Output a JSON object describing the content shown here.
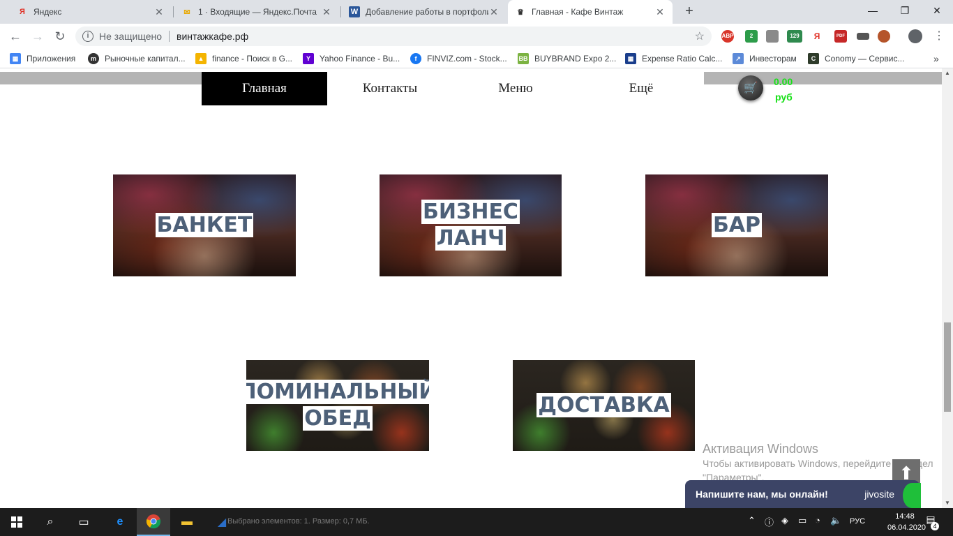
{
  "browser": {
    "tabs": [
      {
        "title": "Яндекс",
        "icon": "yandex-icon",
        "active": false
      },
      {
        "title": "1 · Входящие — Яндекс.Почта",
        "icon": "mail-icon",
        "active": false
      },
      {
        "title": "Добавление работы в портфоли",
        "icon": "word-icon",
        "active": false
      },
      {
        "title": "Главная - Кафе Винтаж",
        "icon": "chef-hat-icon",
        "active": true
      }
    ],
    "new_tab": "+",
    "window_controls": {
      "minimize": "—",
      "maximize": "❐",
      "close": "✕"
    },
    "omnibox": {
      "security_label": "Не защищено",
      "url": "винтажкафе.рф"
    },
    "extensions": [
      {
        "icon": "adblock-icon",
        "label": "ABP",
        "color": "#d9352a"
      },
      {
        "icon": "shield-green-icon",
        "label": "2",
        "color": "#2d9c4a"
      },
      {
        "icon": "shield-gray-icon",
        "label": "",
        "color": "#8a8a8a"
      },
      {
        "icon": "lock-counter-icon",
        "label": "129",
        "color": "#2f8a4e"
      },
      {
        "icon": "yandex-ext-icon",
        "label": "Я",
        "color": "#e03126"
      },
      {
        "icon": "pdf-icon",
        "label": "PDF",
        "color": "#c62828"
      },
      {
        "icon": "hat-icon",
        "label": "",
        "color": "#555555"
      },
      {
        "icon": "avatar-ext-icon",
        "label": "",
        "color": "#b5542a"
      }
    ],
    "bookmarks": [
      {
        "label": "Приложения",
        "icon": "apps-grid-icon",
        "color": "#4285f4"
      },
      {
        "label": "Рыночные капитал...",
        "icon": "chart-logo-icon",
        "color": "#333333"
      },
      {
        "label": "finance - Поиск в G...",
        "icon": "google-drive-icon",
        "color": "#f4b400"
      },
      {
        "label": "Yahoo Finance - Bu...",
        "icon": "yahoo-icon",
        "color": "#6001d2"
      },
      {
        "label": "FINVIZ.com - Stock...",
        "icon": "facebook-icon",
        "color": "#1877f2"
      },
      {
        "label": "BUYBRAND Expo 2...",
        "icon": "bb-icon",
        "color": "#7cb342"
      },
      {
        "label": "Expense Ratio Calc...",
        "icon": "calculator-icon",
        "color": "#1a3e8c"
      },
      {
        "label": "Инвесторам",
        "icon": "link-icon",
        "color": "#5c8ad8"
      },
      {
        "label": "Conomy — Сервис...",
        "icon": "conomy-icon",
        "color": "#2e3b2a"
      }
    ],
    "bookmarks_more": "»"
  },
  "site": {
    "nav": [
      {
        "label": "Главная",
        "active": true
      },
      {
        "label": "Контакты",
        "active": false
      },
      {
        "label": "Меню",
        "active": false
      },
      {
        "label": "Ещё",
        "active": false
      }
    ],
    "cart": {
      "amount": "0.00",
      "currency": "руб"
    },
    "tiles": [
      {
        "lines": [
          "БАНКЕТ"
        ],
        "style": "restaurant"
      },
      {
        "lines": [
          "БИЗНЕС",
          "ЛАНЧ"
        ],
        "style": "restaurant"
      },
      {
        "lines": [
          "БАР"
        ],
        "style": "restaurant"
      },
      {
        "lines": [
          "ПОМИНАЛЬНЫЙ",
          "ОБЕД"
        ],
        "style": "food"
      },
      {
        "lines": [
          "ДОСТАВКА"
        ],
        "style": "food"
      }
    ],
    "windows_activation": {
      "title": "Активация Windows",
      "text": "Чтобы активировать Windows, перейдите в раздел \"Параметры\"."
    },
    "chat": {
      "message": "Напишите нам, мы онлайн!",
      "brand": "jivosite"
    }
  },
  "taskbar": {
    "status_text": "Выбрано элементов: 1. Размер: 0,7 МБ.",
    "language": "РУС",
    "time": "14:48",
    "date": "06.04.2020",
    "notifications": "4"
  }
}
